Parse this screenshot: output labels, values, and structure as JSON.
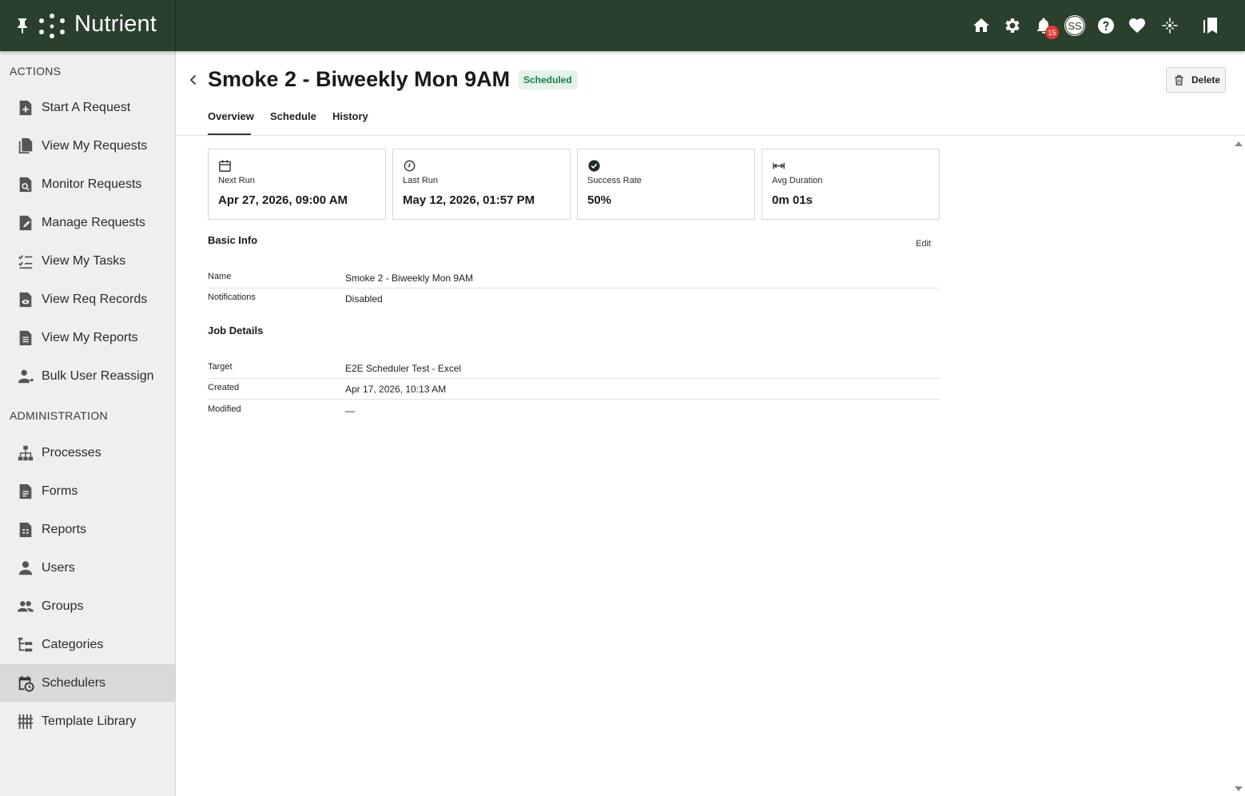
{
  "brand": {
    "name": "Nutrient"
  },
  "topbar": {
    "notification_count": "15",
    "avatar_initials": "SS"
  },
  "sidebar": {
    "actions_label": "ACTIONS",
    "actions": [
      {
        "label": "Start A Request",
        "icon": "file-plus-icon"
      },
      {
        "label": "View My Requests",
        "icon": "files-icon"
      },
      {
        "label": "Monitor Requests",
        "icon": "file-search-icon"
      },
      {
        "label": "Manage Requests",
        "icon": "file-edit-icon"
      },
      {
        "label": "View My Tasks",
        "icon": "task-list-icon"
      },
      {
        "label": "View Req Records",
        "icon": "file-eye-icon"
      },
      {
        "label": "View My Reports",
        "icon": "report-icon"
      },
      {
        "label": "Bulk User Reassign",
        "icon": "user-reassign-icon"
      }
    ],
    "admin_label": "ADMINISTRATION",
    "admin": [
      {
        "label": "Processes",
        "icon": "hierarchy-icon"
      },
      {
        "label": "Forms",
        "icon": "form-icon"
      },
      {
        "label": "Reports",
        "icon": "report-grid-icon"
      },
      {
        "label": "Users",
        "icon": "user-icon"
      },
      {
        "label": "Groups",
        "icon": "group-icon"
      },
      {
        "label": "Categories",
        "icon": "categories-icon"
      },
      {
        "label": "Schedulers",
        "icon": "calendar-clock-icon",
        "active": true
      },
      {
        "label": "Template Library",
        "icon": "library-icon"
      }
    ]
  },
  "page": {
    "title": "Smoke 2 - Biweekly Mon 9AM",
    "status": "Scheduled",
    "delete_label": "Delete",
    "tabs": [
      "Overview",
      "Schedule",
      "History"
    ],
    "active_tab": "Overview"
  },
  "stats": [
    {
      "label": "Next Run",
      "value": "Apr 27, 2026, 09:00 AM",
      "icon": "calendar-icon"
    },
    {
      "label": "Last Run",
      "value": "May 12, 2026, 01:57 PM",
      "icon": "clock-icon"
    },
    {
      "label": "Success Rate",
      "value": "50%",
      "icon": "check-circle-icon"
    },
    {
      "label": "Avg Duration",
      "value": "0m 01s",
      "icon": "duration-icon"
    }
  ],
  "basic_info": {
    "title": "Basic Info",
    "edit_label": "Edit",
    "rows": [
      {
        "key": "Name",
        "value": "Smoke 2 - Biweekly Mon 9AM"
      },
      {
        "key": "Notifications",
        "value": "Disabled"
      }
    ]
  },
  "job_details": {
    "title": "Job Details",
    "rows": [
      {
        "key": "Target",
        "value": "E2E Scheduler Test - Excel"
      },
      {
        "key": "Created",
        "value": "Apr 17, 2026, 10:13 AM"
      },
      {
        "key": "Modified",
        "value": "—"
      }
    ]
  },
  "colors": {
    "topbar": "#2b3f2d",
    "status_bg": "#e4f4ea",
    "status_text": "#1f7a4a",
    "badge": "#e53935"
  }
}
